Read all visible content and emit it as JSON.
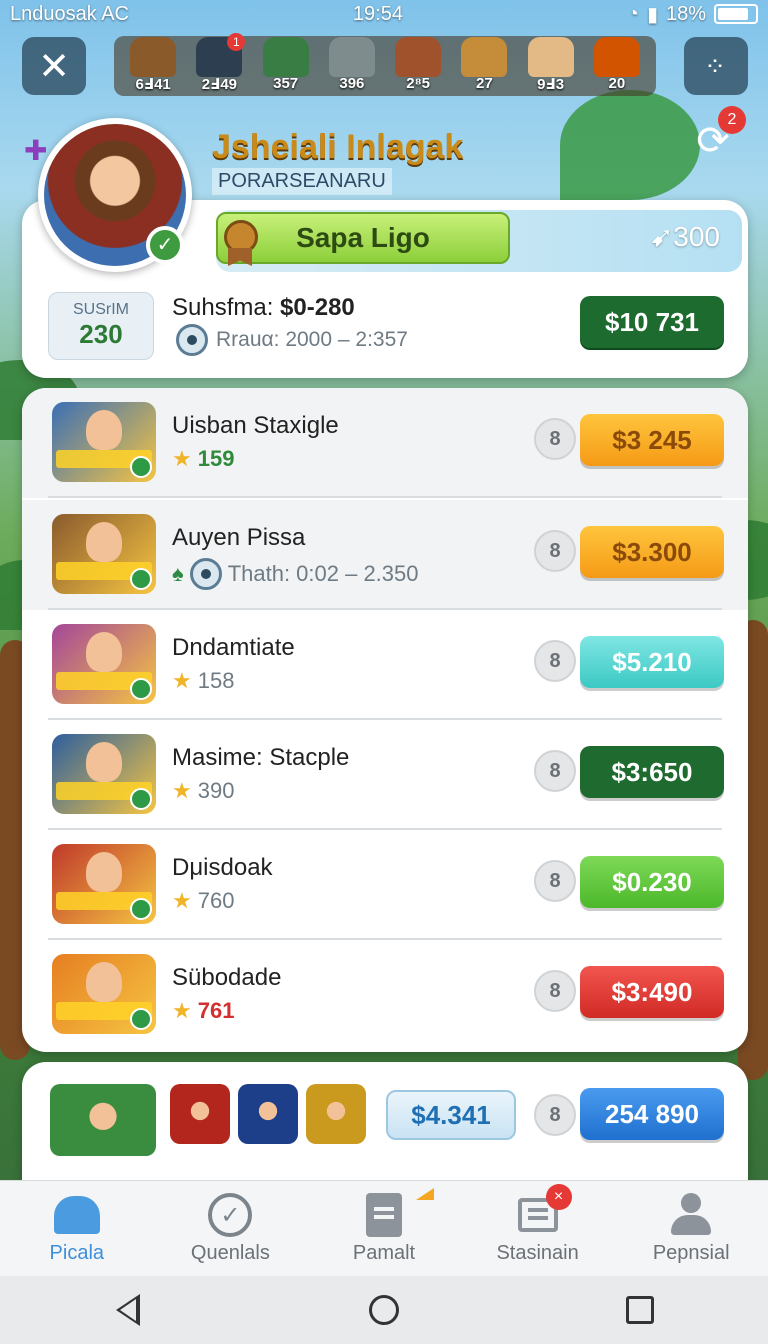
{
  "status_bar": {
    "carrier": "Lnduosak AC",
    "time": "19:54",
    "battery": "18%"
  },
  "top_bar": {
    "characters": [
      {
        "score": "6Ⅎ41",
        "color": "#8b5a2b",
        "badge": ""
      },
      {
        "score": "2Ⅎ49",
        "color": "#2c3e50",
        "badge": "1"
      },
      {
        "score": "357",
        "color": "#3a7d44",
        "badge": ""
      },
      {
        "score": "396",
        "color": "#7f8c8d",
        "badge": ""
      },
      {
        "score": "2⁸5",
        "color": "#a0522d",
        "badge": ""
      },
      {
        "score": "27",
        "color": "#c58c3a",
        "badge": ""
      },
      {
        "score": "9Ⅎ3",
        "color": "#e3b985",
        "badge": ""
      },
      {
        "score": "20",
        "color": "#d35400",
        "badge": ""
      }
    ]
  },
  "profile": {
    "name": "Jsheiali Inlagak",
    "subtitle": "PORARSEANARU",
    "notification_count": "2"
  },
  "summary": {
    "league_label": "Sapa Ligo",
    "league_points": "300",
    "box_label": "SUSrIM",
    "box_value": "230",
    "title_prefix": "Suhsfma: ",
    "title_value": "$0-280",
    "subline": "Rrauα: 2000 – 2:357",
    "total": "$10 731"
  },
  "rows": [
    {
      "name": "Uisban Staxigle",
      "meta_icon": "star",
      "meta": "159",
      "count": "8",
      "price": "$3 245",
      "price_style": "orange",
      "thumb_color": "#3b6fb6",
      "shaded": true
    },
    {
      "name": "Auyen Pissa",
      "meta_icon": "drop",
      "meta": "Thath: 0:02 – 2.350",
      "count": "8",
      "price": "$3.300",
      "price_style": "orange",
      "thumb_color": "#8a5a2e",
      "shaded": true
    },
    {
      "name": "Dndamtiate",
      "meta_icon": "star",
      "meta": "158",
      "count": "8",
      "price": "$5.210",
      "price_style": "teal",
      "thumb_color": "#a4469a",
      "shaded": false
    },
    {
      "name": "Masime: Stacple",
      "meta_icon": "star",
      "meta": "390",
      "count": "8",
      "price": "$3:650",
      "price_style": "darkgreen",
      "thumb_color": "#2d5f9e",
      "shaded": false
    },
    {
      "name": "Dμisdoak",
      "meta_icon": "star",
      "meta": "760",
      "count": "8",
      "price": "$0.230",
      "price_style": "lightgreen",
      "thumb_color": "#c0392b",
      "shaded": false
    },
    {
      "name": "Sübodade",
      "meta_icon": "star",
      "meta": "761",
      "count": "8",
      "price": "$3:490",
      "price_style": "red",
      "thumb_color": "#e67e22",
      "shaded": false
    }
  ],
  "bottom_card": {
    "outline_price": "$4.341",
    "count": "8",
    "blue_price": "254 890",
    "thumb_colors": [
      "#3a8d3f",
      "#b3261e",
      "#1d3f8a",
      "#c99a1e"
    ]
  },
  "nav": [
    {
      "label": "Picala",
      "icon": "home-icon",
      "active": true
    },
    {
      "label": "Quenlals",
      "icon": "check-circle-icon",
      "active": false
    },
    {
      "label": "Pamalt",
      "icon": "document-icon",
      "active": false
    },
    {
      "label": "Stasinain",
      "icon": "list-icon",
      "active": false,
      "badge": "×"
    },
    {
      "label": "Pepnsial",
      "icon": "person-icon",
      "active": false
    }
  ],
  "accent_colors": {
    "brand_green": "#1d6b2e",
    "nav_active": "#3d8fd8",
    "badge_red": "#e53935"
  }
}
